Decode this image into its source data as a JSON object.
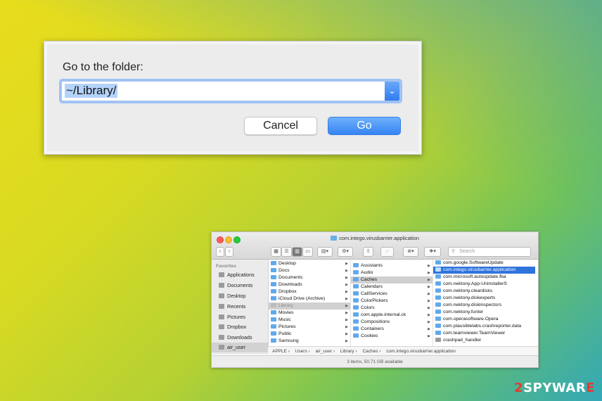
{
  "dialog": {
    "label": "Go to the folder:",
    "path_value": "~/Library/",
    "dropdown_glyph": "⌄",
    "cancel_label": "Cancel",
    "go_label": "Go"
  },
  "finder": {
    "title": "com.intego.virusbarrier.application",
    "search_placeholder": "Search",
    "sidebar": {
      "heading": "Favorites",
      "items": [
        {
          "label": "Applications",
          "icon": "applications-icon"
        },
        {
          "label": "Documents",
          "icon": "documents-icon"
        },
        {
          "label": "Desktop",
          "icon": "desktop-icon"
        },
        {
          "label": "Recents",
          "icon": "recents-icon"
        },
        {
          "label": "Pictures",
          "icon": "pictures-icon"
        },
        {
          "label": "Dropbox",
          "icon": "dropbox-icon"
        },
        {
          "label": "Downloads",
          "icon": "downloads-icon"
        },
        {
          "label": "air_user",
          "icon": "home-icon"
        }
      ]
    },
    "column1": [
      "Desktop",
      "Docs",
      "Documents",
      "Downloads",
      "Dropbox",
      "iCloud Drive (Archive)",
      "Library",
      "Movies",
      "Music",
      "Pictures",
      "Public",
      "Samsung"
    ],
    "column2": [
      "Assistants",
      "Audio",
      "Caches",
      "Calendars",
      "CallServices",
      "ColorPickers",
      "Colors",
      "com.apple.internal.ck",
      "Compositions",
      "Containers",
      "Cookies"
    ],
    "column3": [
      "com.google.SoftwareUpdate",
      "com.intego.virusbarrier.application",
      "com.microsoft.autoupdate.fba",
      "com.nektony.App-UninstallerS",
      "com.nektony.cleardisks",
      "com.nektony.diskexperts",
      "com.nektony.diskinspectors",
      "com.nektony.funter",
      "com.operasoftware.Opera",
      "com.plausiblelabs.crashreporter.data",
      "com.teamviewer.TeamViewer",
      "crashpad_handler"
    ],
    "path_bar": [
      "APPLE",
      "Users",
      "air_user",
      "Library",
      "Caches",
      "com.intego.virusbarrier.application"
    ],
    "status": "3 items, 50.71 GB available"
  },
  "watermark": {
    "prefix": "2",
    "text": "SPYWAR",
    "suffix": "E"
  }
}
